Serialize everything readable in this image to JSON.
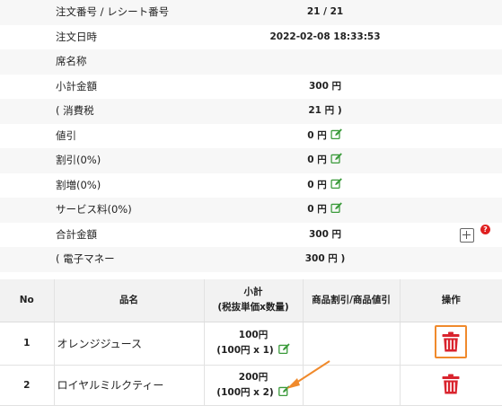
{
  "summary": {
    "order_no_label": "注文番号 / レシート番号",
    "order_no_value": "21 / 21",
    "order_date_label": "注文日時",
    "order_date_value": "2022-02-08 18:33:53",
    "seat_label": "席名称",
    "seat_value": "",
    "subtotal_label": "小計金額",
    "subtotal_value": "300",
    "tax_label": "( 消費税",
    "tax_value": "21",
    "price_discount_label": "値引",
    "price_discount_value": "0",
    "rate_discount_label": "割引(0%)",
    "rate_discount_value": "0",
    "surcharge_label": "割増(0%)",
    "surcharge_value": "0",
    "service_label": "サービス料(0%)",
    "service_value": "0",
    "total_label": "合計金額",
    "total_value": "300",
    "emoney_label": "( 電子マネー",
    "emoney_value": "300",
    "yen": "円",
    "close_paren": ")",
    "help_glyph": "?"
  },
  "items_table": {
    "headers": {
      "no": "No",
      "name": "品名",
      "subtotal_line1": "小計",
      "subtotal_line2": "(税抜単価x数量)",
      "item_discount": "商品割引/商品値引",
      "action": "操作"
    },
    "rows": [
      {
        "no": "1",
        "name": "オレンジジュース",
        "subtotal": "100円",
        "detail": "(100円 x 1)",
        "discount": ""
      },
      {
        "no": "2",
        "name": "ロイヤルミルクティー",
        "subtotal": "200円",
        "detail": "(100円 x 2)",
        "discount": ""
      }
    ]
  },
  "icons": {
    "edit": "edit-icon",
    "delete": "trash-icon",
    "add": "plus-square-icon",
    "help": "question-circle-icon",
    "annotation": "arrow-annotation"
  },
  "colors": {
    "edit_green": "#3a9a3a",
    "delete_red": "#d9232d",
    "highlight_orange": "#f08a2c",
    "help_red": "#e02020"
  }
}
